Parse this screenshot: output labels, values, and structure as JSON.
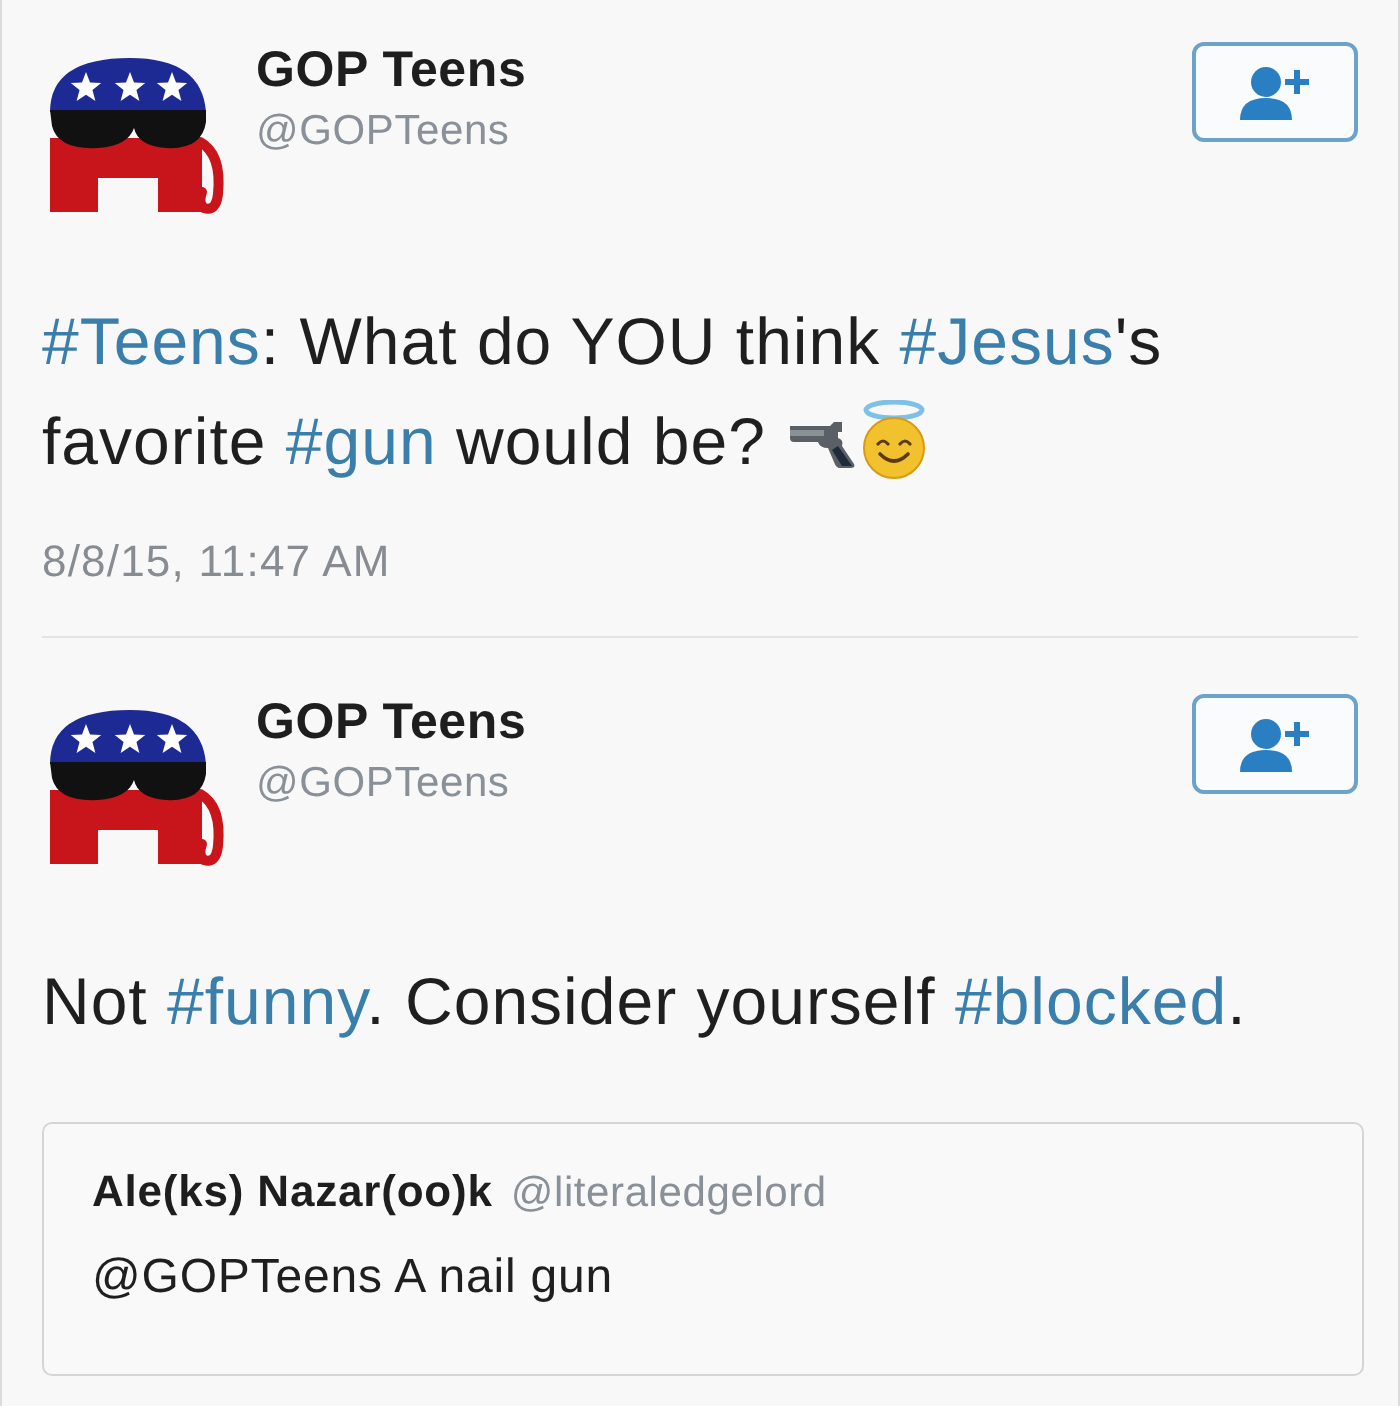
{
  "tweets": [
    {
      "name": "GOP Teens",
      "handle": "@GOPTeens",
      "segments": [
        {
          "kind": "hashtag",
          "text": "#Teens"
        },
        {
          "kind": "text",
          "text": ": What do YOU think "
        },
        {
          "kind": "hashtag",
          "text": "#Jesus"
        },
        {
          "kind": "text",
          "text": "'s favorite "
        },
        {
          "kind": "hashtag",
          "text": "#gun"
        },
        {
          "kind": "text",
          "text": " would be? "
        },
        {
          "kind": "pistol"
        },
        {
          "kind": "angel"
        }
      ],
      "timestamp": "8/8/15, 11:47 AM"
    },
    {
      "name": "GOP Teens",
      "handle": "@GOPTeens",
      "segments": [
        {
          "kind": "text",
          "text": "Not "
        },
        {
          "kind": "hashtag",
          "text": "#funny"
        },
        {
          "kind": "text",
          "text": ". Consider yourself "
        },
        {
          "kind": "hashtag",
          "text": "#blocked"
        },
        {
          "kind": "text",
          "text": "."
        }
      ],
      "quoted_tweet": {
        "name": "Ale(ks) Nazar(oo)k",
        "handle": "@literaledgelord",
        "text": "@GOPTeens A nail gun"
      }
    }
  ]
}
